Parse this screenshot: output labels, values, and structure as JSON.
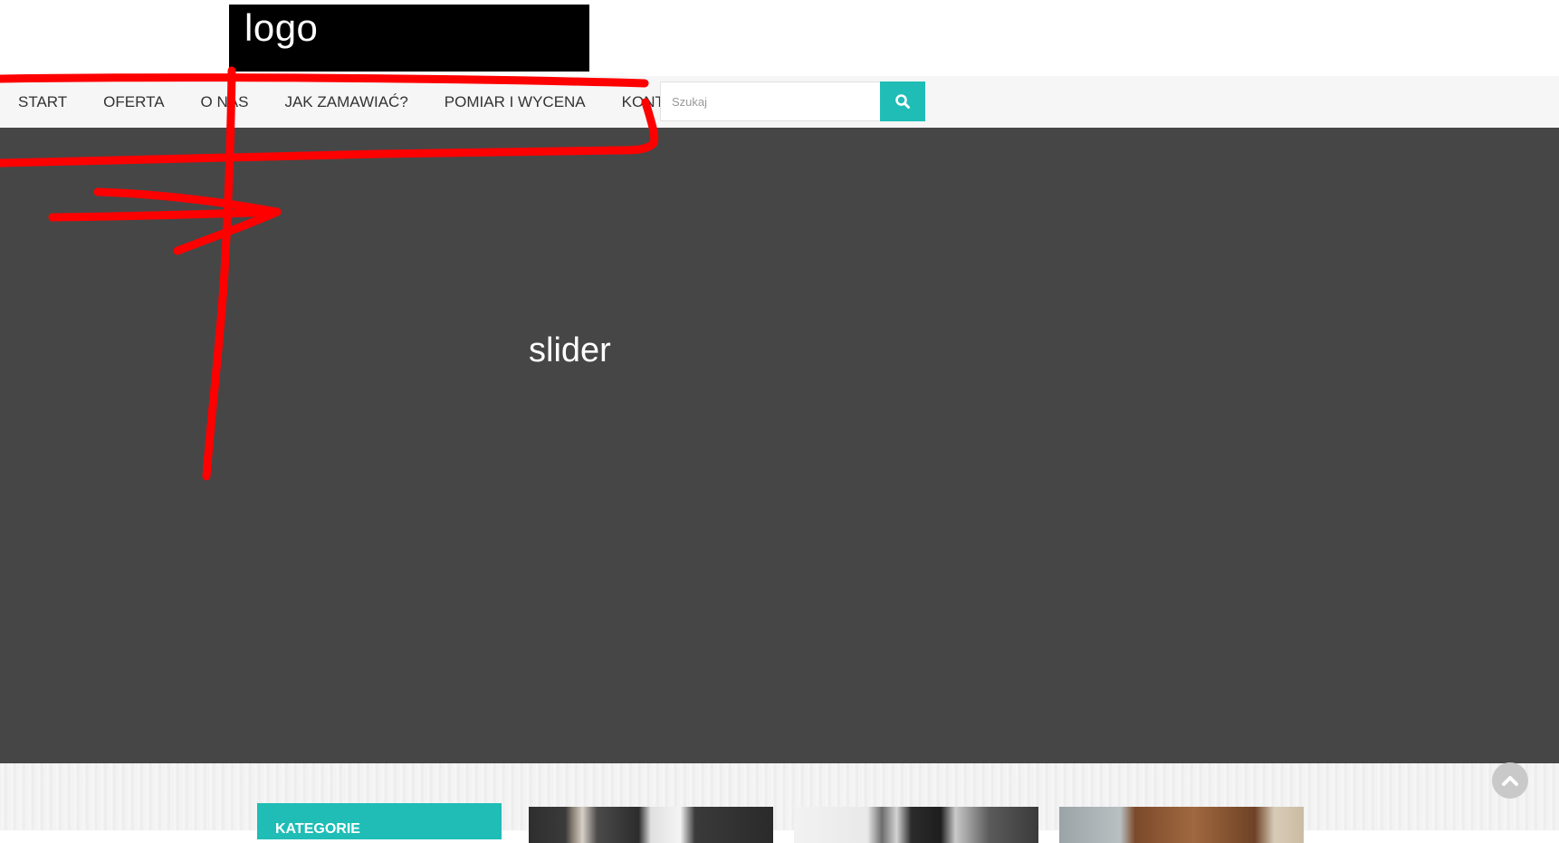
{
  "header": {
    "logo_text": "logo"
  },
  "nav": {
    "items": [
      {
        "label": "START"
      },
      {
        "label": "OFERTA"
      },
      {
        "label": "O NAS"
      },
      {
        "label": "JAK ZAMAWIAĆ?"
      },
      {
        "label": "POMIAR I WYCENA"
      },
      {
        "label": "KONTAKT"
      }
    ],
    "search": {
      "placeholder": "Szukaj",
      "value": "",
      "button_icon": "search-icon"
    }
  },
  "slider": {
    "text": "slider"
  },
  "sidebar": {
    "categories_title": "KATEGORIE"
  },
  "colors": {
    "accent": "#1fbdb6",
    "slider_bg": "#464646",
    "nav_bg": "#f6f6f6",
    "annotation": "#ff0000"
  },
  "icons": {
    "scroll_top": "chevron-up-icon",
    "search": "search-icon"
  }
}
